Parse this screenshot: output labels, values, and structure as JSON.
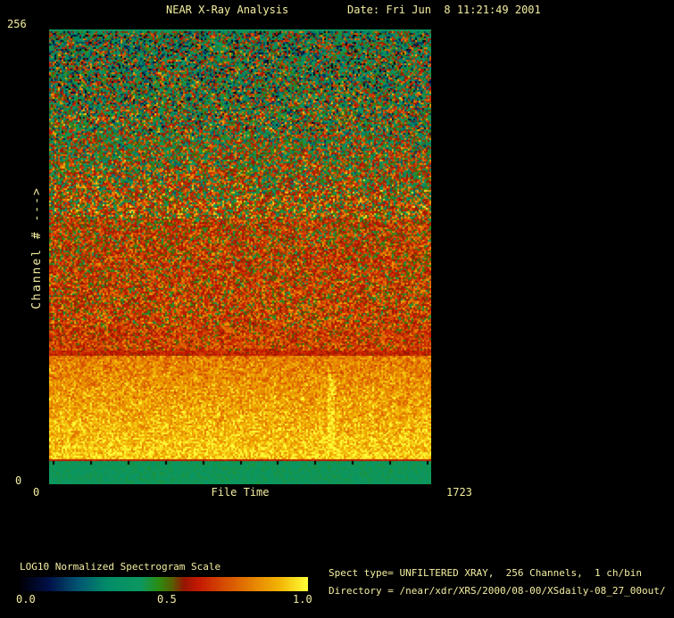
{
  "window": {
    "bg_color": "#000000",
    "text_color": "#f5efa0",
    "title": "NEAR X-Ray Analysis",
    "date": "Date: Fri Jun  8 11:21:49 2001"
  },
  "chart_data": {
    "type": "heatmap",
    "title": "NEAR X-Ray Analysis",
    "xlabel": "File Time",
    "ylabel": "Channel # --->",
    "x_range": [
      0,
      1723
    ],
    "y_range": [
      0,
      256
    ],
    "x_tick_labels": {
      "min": "0",
      "max": "1723"
    },
    "y_tick_labels": {
      "min": "0",
      "max": "256"
    },
    "x_minor_ticks": {
      "count": 11,
      "channel": 13,
      "color": "#000000"
    },
    "description": "LOG10-normalized X-ray spectrogram, 256 channels vs file time 0-1723. Channels ~197-256: green noise (~0.4) with dark blue/black and red specks; ~150-197: green-to-red mottled transition; ~75-150: red/orange noise (~0.62-0.68); ~14-72: bright orange-yellow band (~0.80-0.94, brightest at bottom, faint brighter vertical streaks near x-fractions 0.735 and 0.845); channels 0-13: solid mid-scale green (~0.42).",
    "colormap": [
      [
        0.0,
        "#000006"
      ],
      [
        0.1,
        "#001048"
      ],
      [
        0.2,
        "#005472"
      ],
      [
        0.3,
        "#008c68"
      ],
      [
        0.42,
        "#0d9760"
      ],
      [
        0.48,
        "#2a8e14"
      ],
      [
        0.53,
        "#575e00"
      ],
      [
        0.57,
        "#951500"
      ],
      [
        0.62,
        "#c41800"
      ],
      [
        0.7,
        "#d44700"
      ],
      [
        0.8,
        "#e47d00"
      ],
      [
        0.9,
        "#f2b302"
      ],
      [
        1.0,
        "#ffff38"
      ]
    ],
    "bands": [
      {
        "ch": [
          255,
          256.5
        ],
        "v": [
          0.42,
          0.42
        ],
        "noise": 0.0
      },
      {
        "ch": [
          197,
          255
        ],
        "v": [
          0.5,
          0.4
        ],
        "noise": 0.5
      },
      {
        "ch": [
          150,
          197
        ],
        "v": [
          0.62,
          0.5
        ],
        "noise": 0.42
      },
      {
        "ch": [
          88,
          150
        ],
        "v": [
          0.66,
          0.62
        ],
        "noise": 0.28
      },
      {
        "ch": [
          75,
          88
        ],
        "v": [
          0.68,
          0.66
        ],
        "noise": 0.22
      },
      {
        "ch": [
          72,
          75
        ],
        "v": [
          0.62,
          0.64
        ],
        "noise": 0.1
      },
      {
        "ch": [
          14,
          72
        ],
        "v": [
          0.94,
          0.8
        ],
        "noise": 0.16
      },
      {
        "ch": [
          13,
          14
        ],
        "v": [
          0.62,
          0.62
        ],
        "noise": 0.04
      },
      {
        "ch": [
          -0.5,
          13
        ],
        "v": [
          0.42,
          0.42
        ],
        "noise": 0.04
      }
    ],
    "streaks": [
      {
        "x_frac": 0.735,
        "w_frac": 0.016,
        "ch": [
          20,
          62
        ],
        "boost": 0.12
      },
      {
        "x_frac": 0.845,
        "w_frac": 0.01,
        "ch": [
          22,
          55
        ],
        "boost": 0.07
      }
    ],
    "colorbar": {
      "title": "LOG10 Normalized Spectrogram Scale",
      "range": [
        0,
        1
      ],
      "tick_labels": [
        "0.0",
        "0.5",
        "1.0"
      ]
    }
  },
  "footer": {
    "spect_type_line": "Spect type= UNFILTERED XRAY,  256 Channels,  1 ch/bin",
    "directory_line": "Directory = /near/xdr/XRS/2000/08-00/XSdaily-08_27_00out/"
  }
}
